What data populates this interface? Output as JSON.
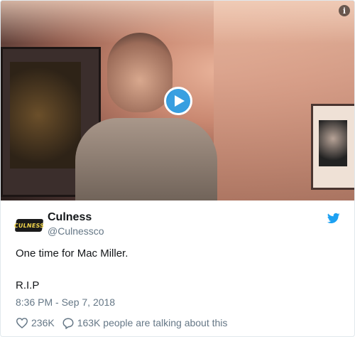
{
  "tweet": {
    "author_name": "Culness",
    "author_handle": "@Culnessco",
    "avatar_text": "CULNESS",
    "text_line1": "One time for Mac Miller.",
    "text_line2": "R.I.P",
    "timestamp": "8:36 PM - Sep 7, 2018",
    "likes": "236K",
    "talking": "163K people are talking about this"
  },
  "media": {
    "play_icon": "play-icon",
    "info_icon_label": "i"
  },
  "colors": {
    "accent": "#1da1f2",
    "text": "#14171a",
    "muted": "#657786"
  }
}
